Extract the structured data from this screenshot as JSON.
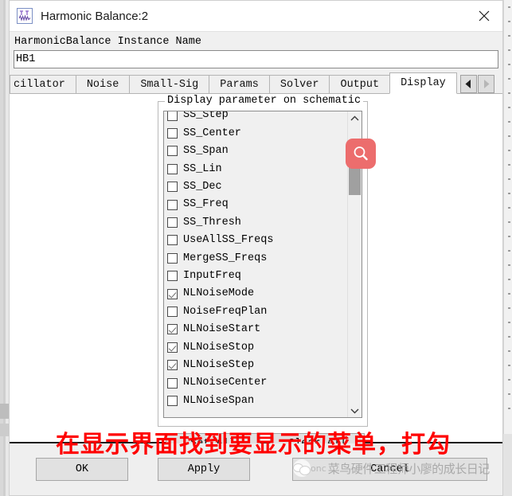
{
  "window": {
    "title": "Harmonic Balance:2",
    "app_icon": "harmonic-balance-icon",
    "close_icon": "close-icon"
  },
  "instance": {
    "label": "HarmonicBalance Instance Name",
    "value": "HB1",
    "placeholder": ""
  },
  "tabs": {
    "items": [
      {
        "label": "cillator",
        "active": false,
        "partial": true
      },
      {
        "label": "Noise",
        "active": false,
        "partial": false
      },
      {
        "label": "Small-Sig",
        "active": false,
        "partial": false
      },
      {
        "label": "Params",
        "active": false,
        "partial": false
      },
      {
        "label": "Solver",
        "active": false,
        "partial": false
      },
      {
        "label": "Output",
        "active": false,
        "partial": false
      },
      {
        "label": "Display",
        "active": true,
        "partial": false
      }
    ],
    "scroll_left_icon": "triangle-left-icon",
    "scroll_right_icon": "triangle-right-icon"
  },
  "display_group": {
    "title": "Display parameter on schematic",
    "parameters": [
      {
        "label": "SS_Step",
        "checked": false
      },
      {
        "label": "SS_Center",
        "checked": false
      },
      {
        "label": "SS_Span",
        "checked": false
      },
      {
        "label": "SS_Lin",
        "checked": false
      },
      {
        "label": "SS_Dec",
        "checked": false
      },
      {
        "label": "SS_Freq",
        "checked": false
      },
      {
        "label": "SS_Thresh",
        "checked": false
      },
      {
        "label": "UseAllSS_Freqs",
        "checked": false
      },
      {
        "label": "MergeSS_Freqs",
        "checked": false
      },
      {
        "label": "InputFreq",
        "checked": false
      },
      {
        "label": "NLNoiseMode",
        "checked": true
      },
      {
        "label": "NoiseFreqPlan",
        "checked": false
      },
      {
        "label": "NLNoiseStart",
        "checked": true
      },
      {
        "label": "NLNoiseStop",
        "checked": true
      },
      {
        "label": "NLNoiseStep",
        "checked": true
      },
      {
        "label": "NLNoiseCenter",
        "checked": false
      },
      {
        "label": "NLNoiseSpan",
        "checked": false
      }
    ],
    "scroll_up_icon": "chevron-up-icon",
    "scroll_down_icon": "chevron-down-icon",
    "set_all_label": "Set All",
    "clear_all_label": "Clear All"
  },
  "footer": {
    "ok_label": "OK",
    "apply_label": "Apply",
    "cancel_label": "Cancel"
  },
  "overlay": {
    "annotation_text": "在显示界面找到要显示的菜单，打勾",
    "annotation_color": "#ff0000",
    "magnifier_icon": "magnifier-icon",
    "magnifier_color": "#ec6d6d",
    "watermark_prefix": "onc",
    "watermark_text": "菜鸟硬件工程师小廖的成长日记"
  }
}
